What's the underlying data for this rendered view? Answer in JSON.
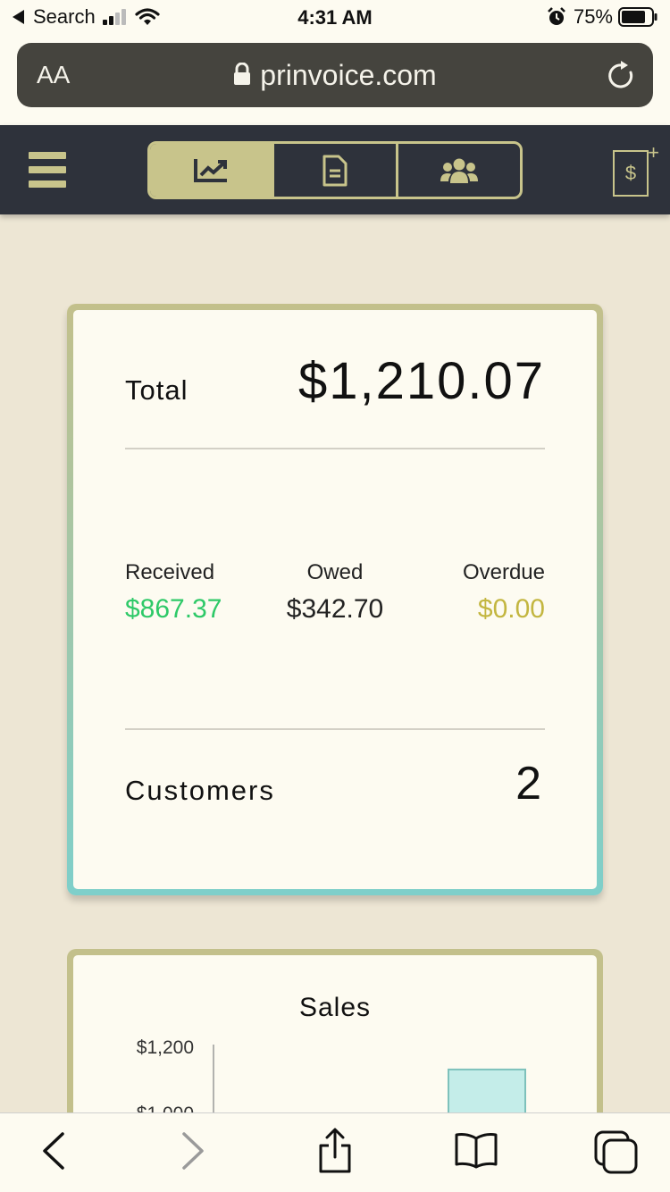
{
  "status_bar": {
    "back_app": "Search",
    "time": "4:31 AM",
    "battery": "75%",
    "icons": [
      "back-arrow-icon",
      "signal-icon",
      "wifi-icon",
      "alarm-icon",
      "battery-icon"
    ]
  },
  "browser": {
    "text_size": "AA",
    "url": "prinvoice.com",
    "icons": [
      "lock-icon",
      "reload-icon"
    ]
  },
  "app_header": {
    "menu_icon": "hamburger-menu-icon",
    "tabs": [
      {
        "icon": "chart-line-icon",
        "active": true
      },
      {
        "icon": "document-icon",
        "active": false
      },
      {
        "icon": "users-icon",
        "active": false
      }
    ],
    "new_invoice_icon": "new-invoice-icon",
    "new_invoice_symbol": "$"
  },
  "summary": {
    "total_label": "Total",
    "total_value": "$1,210.07",
    "received_label": "Received",
    "received_value": "$867.37",
    "owed_label": "Owed",
    "owed_value": "$342.70",
    "overdue_label": "Overdue",
    "overdue_value": "$0.00",
    "customers_label": "Customers",
    "customers_value": "2"
  },
  "colors": {
    "header_bg": "#2e323b",
    "accent": "#c8c48b",
    "received": "#2ec968",
    "overdue": "#c3b640",
    "bar_fill": "#c4ede9",
    "page_bg": "#ede6d4"
  },
  "sales": {
    "title": "Sales"
  },
  "chart_data": {
    "type": "bar",
    "title": "Sales",
    "ytick_labels": [
      "$1,200",
      "$1,000"
    ],
    "values": [
      1130
    ],
    "ylim_visible": [
      1000,
      1200
    ]
  },
  "bottom_toolbar": {
    "icons": [
      "back-icon",
      "forward-icon",
      "share-icon",
      "bookmarks-icon",
      "tabs-icon"
    ]
  }
}
